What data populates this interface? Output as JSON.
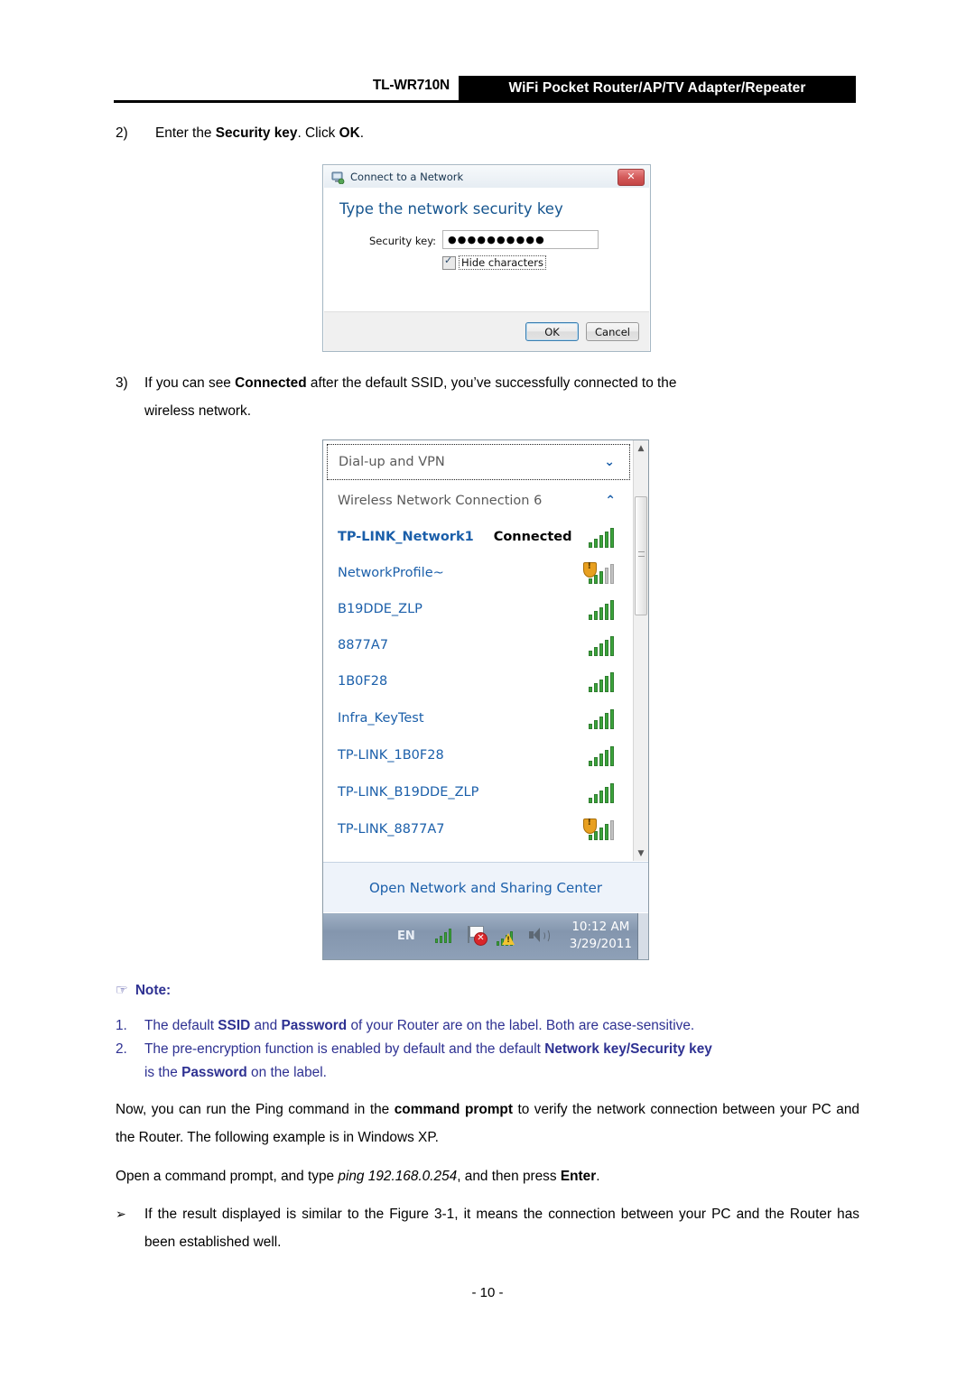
{
  "header": {
    "model": "TL-WR710N",
    "banner": "WiFi Pocket Router/AP/TV Adapter/Repeater"
  },
  "steps": {
    "step2_number": "2)",
    "step2_text_pre": "Enter the ",
    "step2_bold1": "Security key",
    "step2_mid": ". Click ",
    "step2_bold2": "OK",
    "step2_end": ".",
    "step3_number": "3)",
    "step3_pre": "If you can see ",
    "step3_bold": "Connected",
    "step3_post": " after the default SSID, you’ve successfully connected to the",
    "step3_line2": "wireless network."
  },
  "dialog": {
    "title": "Connect to a Network",
    "close_label": "✕",
    "heading": "Type the network security key",
    "field_label": "Security key:",
    "field_value": "●●●●●●●●●●",
    "checkbox_label": "Hide characters",
    "ok_label": "OK",
    "cancel_label": "Cancel"
  },
  "network_panel": {
    "groups": [
      {
        "label": "Dial-up and VPN",
        "chevron": "⌄"
      },
      {
        "label": "Wireless Network Connection 6",
        "chevron": "⌃"
      }
    ],
    "networks": [
      {
        "ssid": "TP-LINK_Network1",
        "status": "Connected",
        "bold": true,
        "bars": 5,
        "secured": false
      },
      {
        "ssid": "NetworkProfile~",
        "status": "",
        "bold": false,
        "bars": 3,
        "secured": true
      },
      {
        "ssid": "B19DDE_ZLP",
        "status": "",
        "bold": false,
        "bars": 5,
        "secured": false
      },
      {
        "ssid": "8877A7",
        "status": "",
        "bold": false,
        "bars": 5,
        "secured": false
      },
      {
        "ssid": "1B0F28",
        "status": "",
        "bold": false,
        "bars": 5,
        "secured": false
      },
      {
        "ssid": "Infra_KeyTest",
        "status": "",
        "bold": false,
        "bars": 5,
        "secured": false
      },
      {
        "ssid": "TP-LINK_1B0F28",
        "status": "",
        "bold": false,
        "bars": 5,
        "secured": false
      },
      {
        "ssid": "TP-LINK_B19DDE_ZLP",
        "status": "",
        "bold": false,
        "bars": 5,
        "secured": false
      },
      {
        "ssid": "TP-LINK_8877A7",
        "status": "",
        "bold": false,
        "bars": 4,
        "secured": true
      }
    ],
    "open_center_link": "Open Network and Sharing Center",
    "scroll_up": "▲",
    "scroll_down": "▼"
  },
  "taskbar": {
    "language": "EN",
    "time": "10:12 AM",
    "date": "3/29/2011"
  },
  "note": {
    "icon": "☞",
    "title": "Note:",
    "item1_number": "1.",
    "item1_pre": "The default ",
    "item1_b1": "SSID",
    "item1_mid": " and ",
    "item1_b2": "Password",
    "item1_post": " of your Router are on the label. Both are case-sensitive.",
    "item2_number": "2.",
    "item2_pre": "The pre-encryption function is enabled by default and the default ",
    "item2_b1": "Network key/Security key",
    "item2_line2_pre": "is the ",
    "item2_line2_b": "Password",
    "item2_line2_post": " on the label."
  },
  "closing": {
    "now_pre": "Now, you can run the Ping command in the ",
    "now_bold": "command prompt",
    "now_post": " to verify the network connection between your PC and the Router. The following example is in Windows XP.",
    "open_pre": "Open a command prompt, and type ",
    "open_italic": "ping 192.168.0.254",
    "open_mid": ", and then press ",
    "open_bold": "Enter",
    "open_end": ".",
    "bullet_mark": "➢",
    "bullet_text": "If the result displayed is similar to the Figure 3-1, it means the connection between your PC and the Router has been established well."
  },
  "footer": {
    "page": "- 10 -"
  }
}
